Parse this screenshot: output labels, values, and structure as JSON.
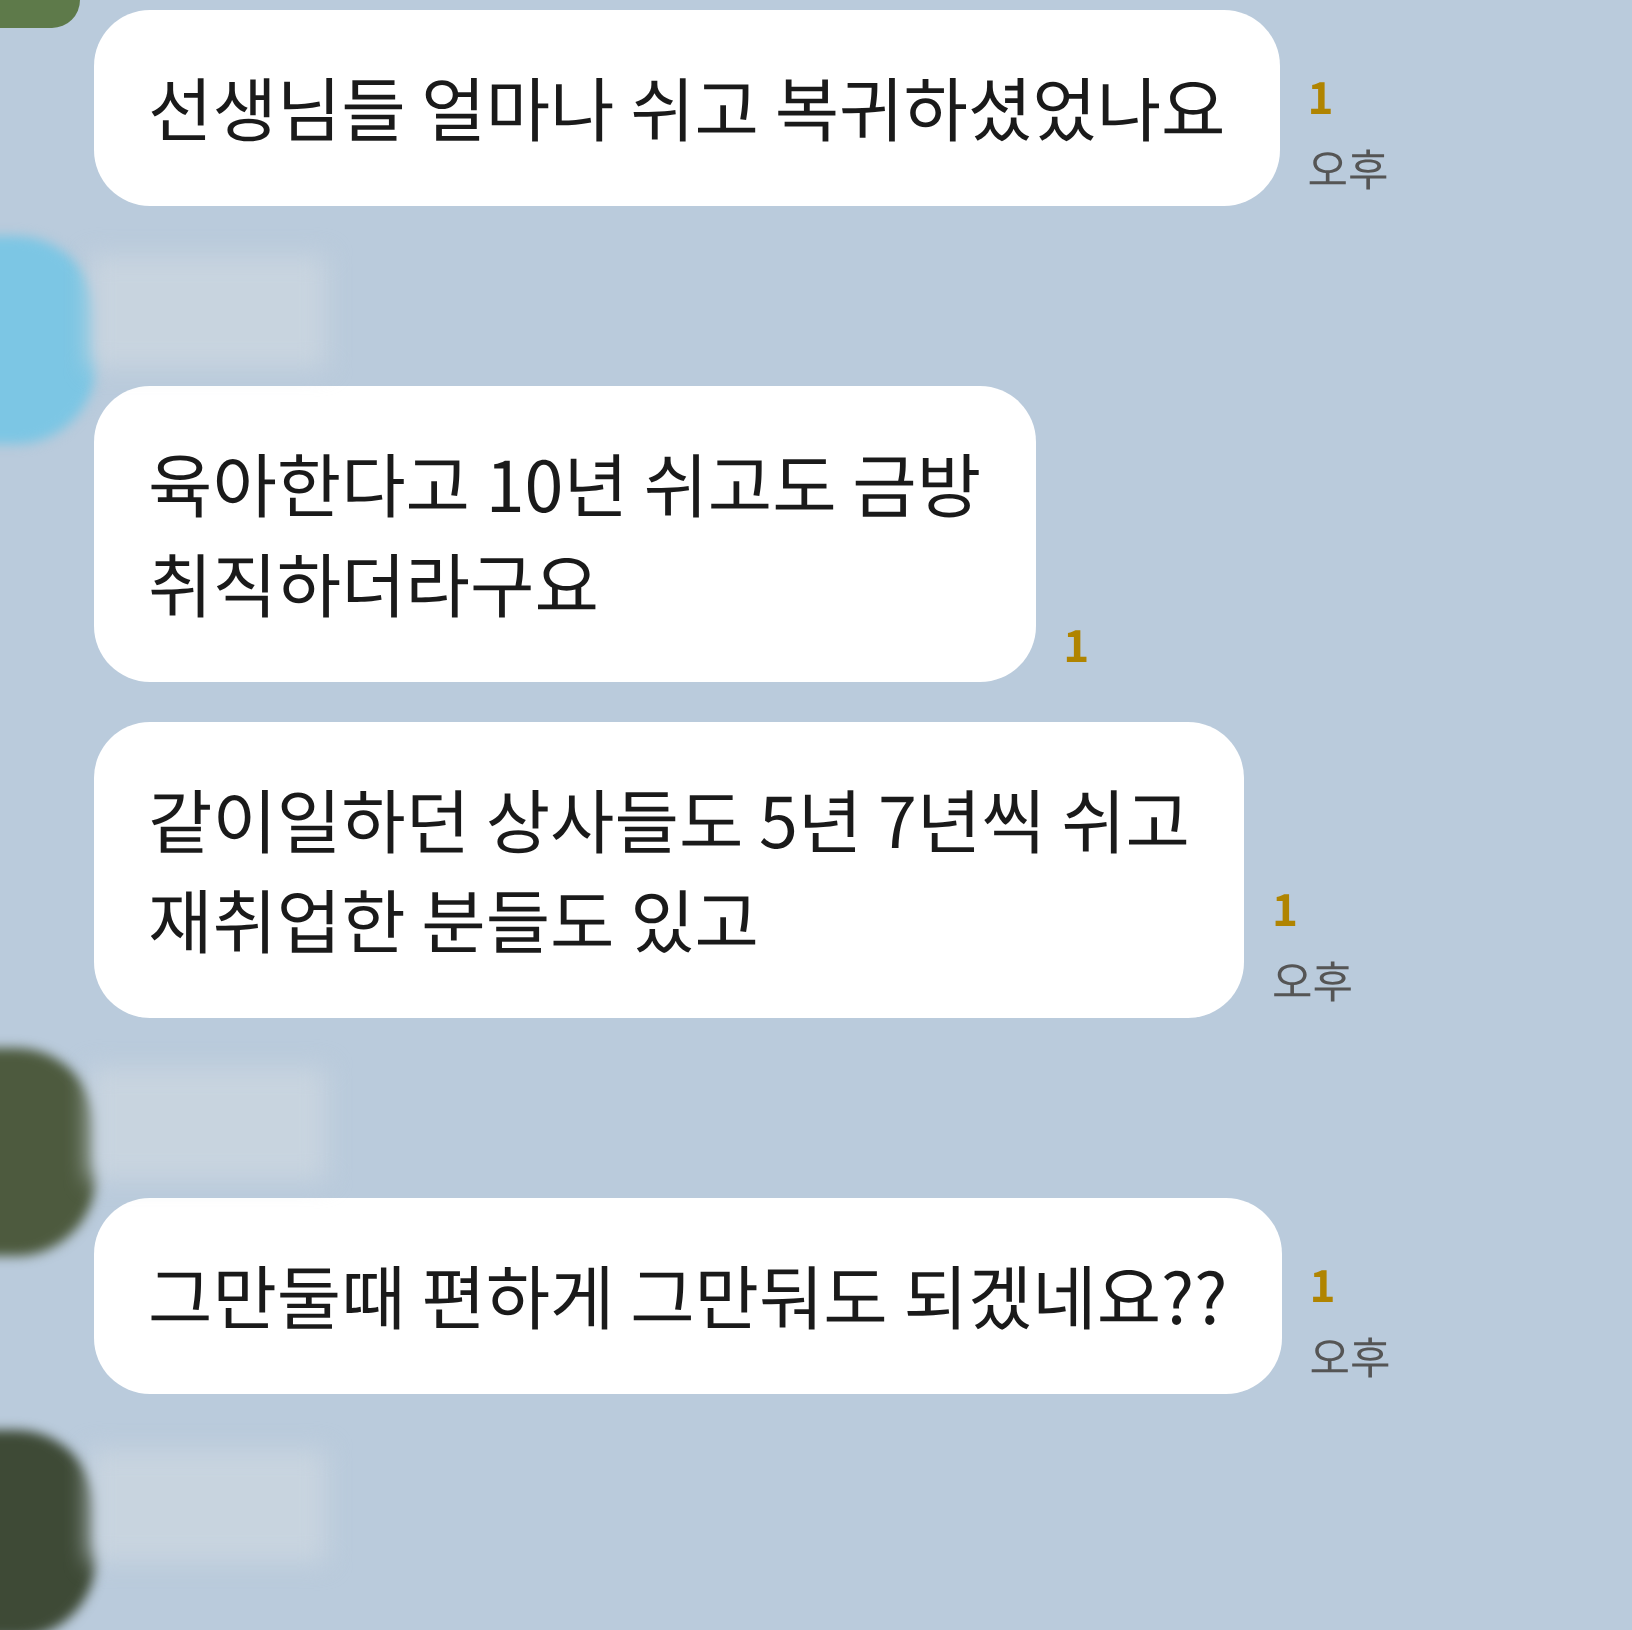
{
  "chat": [
    {
      "kind": "avatar",
      "color": "#5e7a4a"
    },
    {
      "kind": "bubble",
      "text": "선생님들 얼마나 쉬고 복귀하셨었나요",
      "unread": "1",
      "time": "오후"
    },
    {
      "kind": "sender",
      "color": "#7cc6e4"
    },
    {
      "kind": "bubble",
      "text": "육아한다고 10년 쉬고도 금방\n취직하더라구요",
      "unread": "1"
    },
    {
      "kind": "bubble",
      "text": "같이일하던 상사들도 5년 7년씩 쉬고\n재취업한 분들도 있고",
      "unread": "1",
      "time": "오후"
    },
    {
      "kind": "sender",
      "color": "#4d5a3e"
    },
    {
      "kind": "bubble",
      "text": "그만둘때 편하게 그만둬도 되겠네요??",
      "unread": "1",
      "time": "오후"
    },
    {
      "kind": "sender",
      "color": "#3e4a36"
    }
  ]
}
